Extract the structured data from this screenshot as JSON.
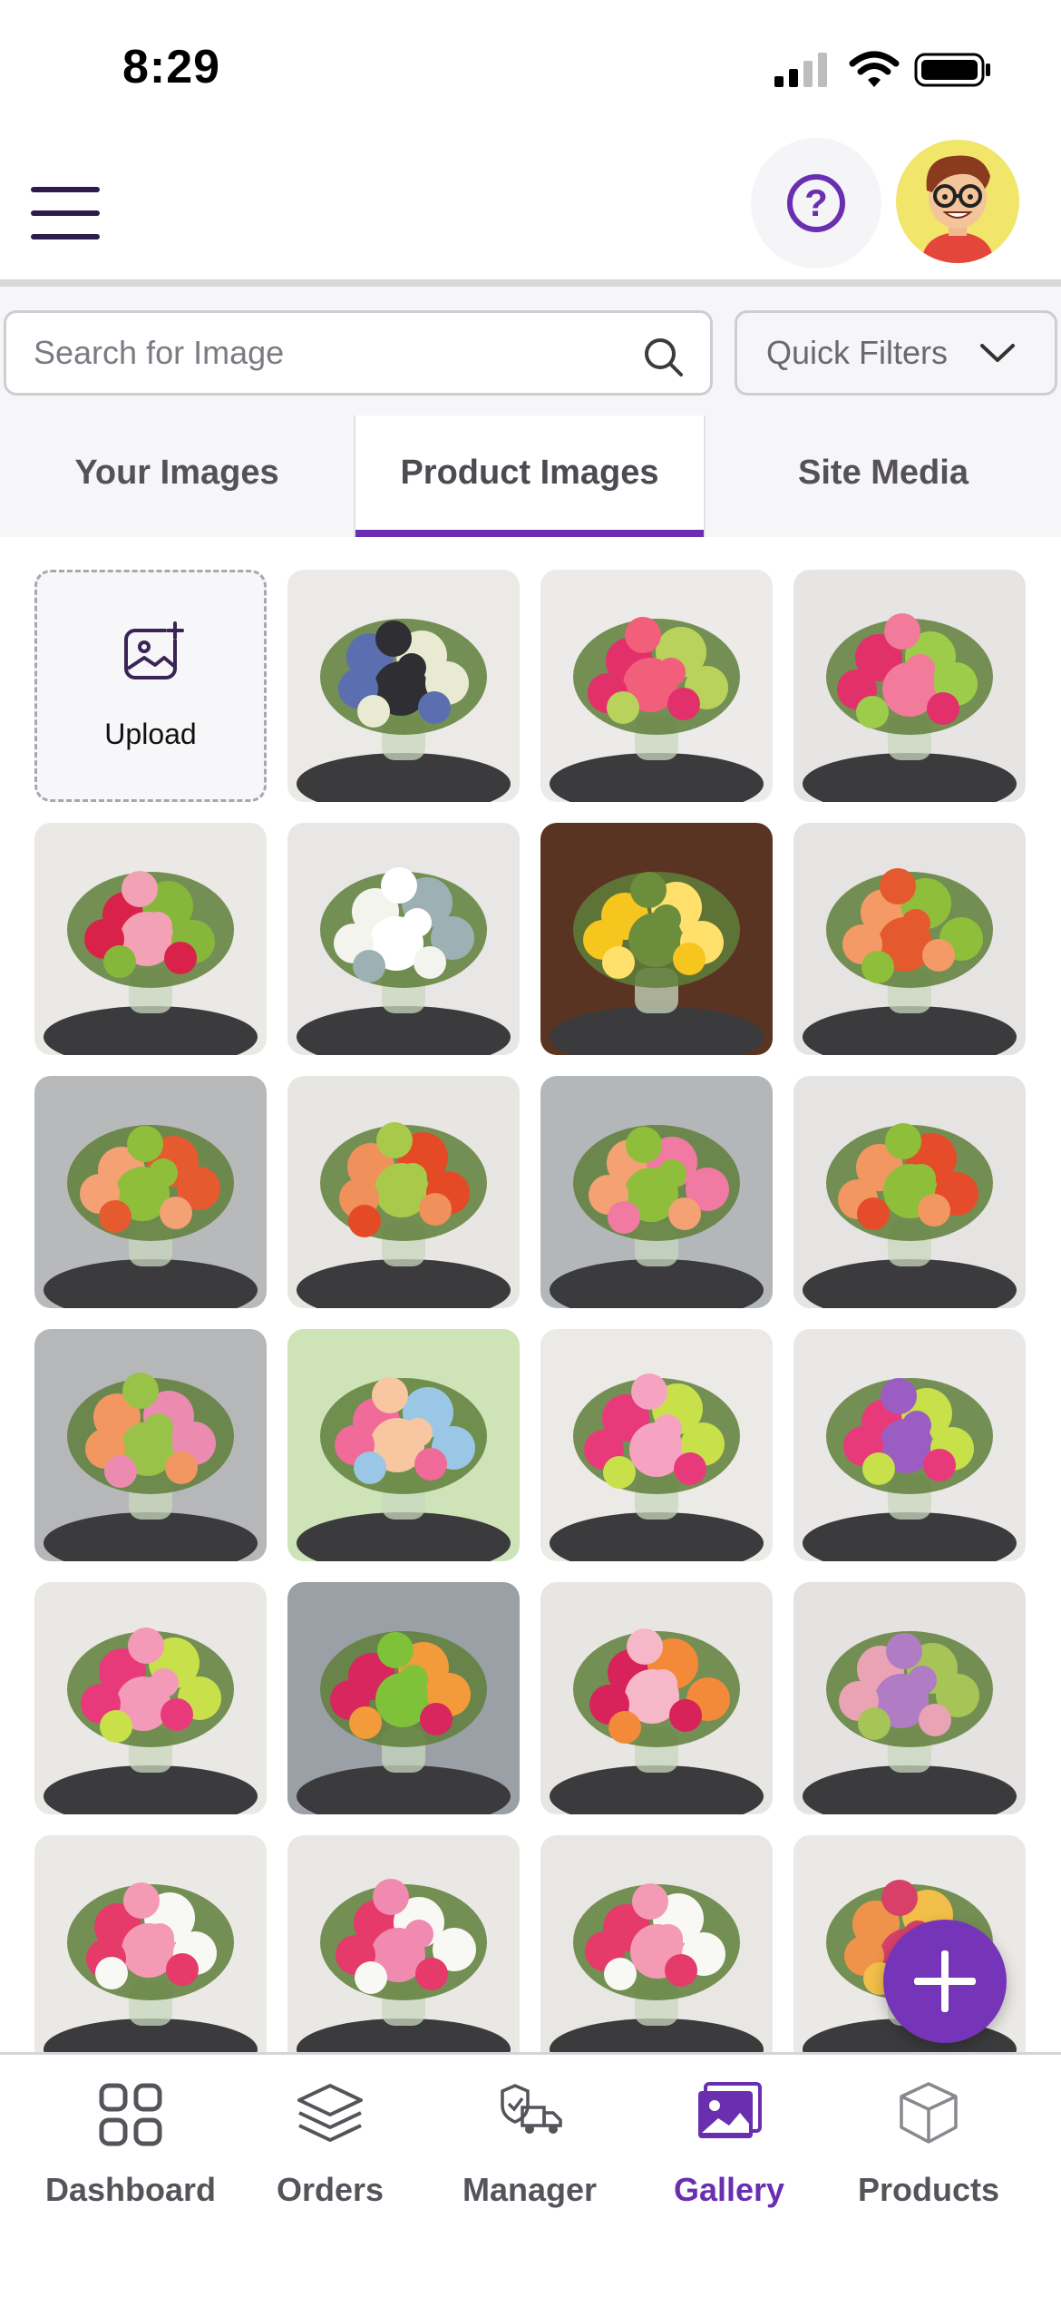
{
  "status_bar": {
    "time": "8:29"
  },
  "header": {
    "menu_icon": "hamburger-icon",
    "help_icon": "help-icon",
    "avatar_icon": "avatar-icon"
  },
  "search": {
    "placeholder": "Search for Image",
    "icon": "search-icon"
  },
  "quick_filters": {
    "label": "Quick Filters",
    "icon": "chevron-down-icon"
  },
  "tabs": [
    {
      "label": "Your Images",
      "active": false
    },
    {
      "label": "Product Images",
      "active": true
    },
    {
      "label": "Site Media",
      "active": false
    }
  ],
  "upload": {
    "label": "Upload",
    "icon": "image-add-icon"
  },
  "gallery": {
    "product_images": [
      {
        "palette": [
          "#5b6fb0",
          "#e9ead2",
          "#2f2f33"
        ],
        "bg": "#eceae6"
      },
      {
        "palette": [
          "#e2306b",
          "#b9d25c",
          "#f15f7a"
        ],
        "bg": "#ecebea"
      },
      {
        "palette": [
          "#e2306b",
          "#9ccc4a",
          "#f27a9a"
        ],
        "bg": "#e6e5e4"
      },
      {
        "palette": [
          "#d8224a",
          "#86b63a",
          "#f3a2b5"
        ],
        "bg": "#ebe9e6"
      },
      {
        "palette": [
          "#f4f4ef",
          "#9db0b4",
          "#ffffff"
        ],
        "bg": "#e8e7e5"
      },
      {
        "palette": [
          "#f6c51e",
          "#ffe06b",
          "#6c8d3b"
        ],
        "bg": "#5a3422"
      },
      {
        "palette": [
          "#f49a66",
          "#8fbf3a",
          "#e45a2e"
        ],
        "bg": "#e5e4e2"
      },
      {
        "palette": [
          "#f4a173",
          "#e55a2f",
          "#8fbf3a"
        ],
        "bg": "#b8b9bb"
      },
      {
        "palette": [
          "#f0905a",
          "#e44a26",
          "#a8c94a"
        ],
        "bg": "#e7e6e3"
      },
      {
        "palette": [
          "#f4a173",
          "#f07aa2",
          "#8fbf3a"
        ],
        "bg": "#b4b7ba"
      },
      {
        "palette": [
          "#f29760",
          "#e54d2a",
          "#8fbf3a"
        ],
        "bg": "#e5e4e2"
      },
      {
        "palette": [
          "#f29760",
          "#ec8bb0",
          "#99c248"
        ],
        "bg": "#b6b7b9"
      },
      {
        "palette": [
          "#f06a9a",
          "#9ac7e6",
          "#f8c6a0"
        ],
        "bg": "#cfe3b8"
      },
      {
        "palette": [
          "#e83a7a",
          "#c8e04a",
          "#f5a3c0"
        ],
        "bg": "#ebeae7"
      },
      {
        "palette": [
          "#e83a7a",
          "#c8e04a",
          "#9b5dc2"
        ],
        "bg": "#e9e8e6"
      },
      {
        "palette": [
          "#e83a7a",
          "#c8e04a",
          "#f39ab8"
        ],
        "bg": "#e9e8e5"
      },
      {
        "palette": [
          "#d8265e",
          "#f39a3a",
          "#7fc23a"
        ],
        "bg": "#9aa0a6"
      },
      {
        "palette": [
          "#d8225a",
          "#f28a3a",
          "#f6b7c9"
        ],
        "bg": "#e8e6e3"
      },
      {
        "palette": [
          "#e9a3b5",
          "#a6c556",
          "#b07cc4"
        ],
        "bg": "#e4e3e1"
      },
      {
        "palette": [
          "#e53a6a",
          "#f8f8f4",
          "#f59ab5"
        ],
        "bg": "#ebe9e6"
      },
      {
        "palette": [
          "#e53a6a",
          "#f8f8f4",
          "#f08ab0"
        ],
        "bg": "#eae8e5"
      },
      {
        "palette": [
          "#e53a6a",
          "#f8f8f4",
          "#f59ab5"
        ],
        "bg": "#e9e7e4"
      },
      {
        "palette": [
          "#f0934a",
          "#f2c04a",
          "#d8406a"
        ],
        "bg": "#ebe9e6"
      }
    ]
  },
  "fab": {
    "icon": "plus-icon"
  },
  "bottom_nav": [
    {
      "label": "Dashboard",
      "icon": "dashboard-grid-icon",
      "active": false
    },
    {
      "label": "Orders",
      "icon": "layers-icon",
      "active": false
    },
    {
      "label": "Manager",
      "icon": "delivery-truck-icon",
      "active": false
    },
    {
      "label": "Gallery",
      "icon": "gallery-image-icon",
      "active": true
    },
    {
      "label": "Products",
      "icon": "cube-icon",
      "active": false
    }
  ],
  "colors": {
    "accent": "#6a2fb0",
    "fab": "#7634b8",
    "text_muted": "#56535a"
  }
}
